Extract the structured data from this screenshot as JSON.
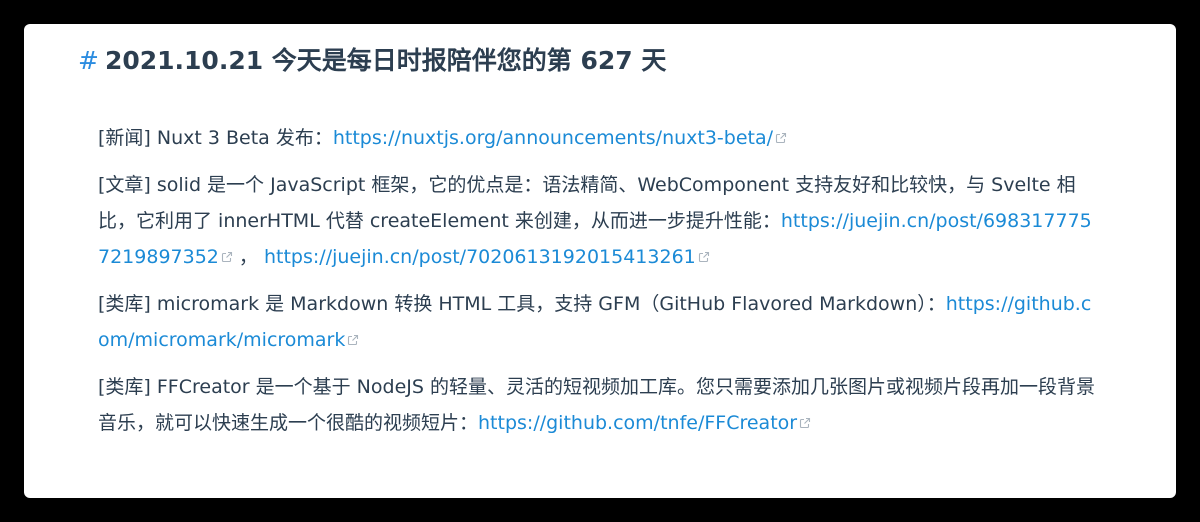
{
  "colors": {
    "text": "#2c3e50",
    "link": "#1b8ad6",
    "hash": "#2b8ce0",
    "background": "#000000",
    "card": "#ffffff"
  },
  "heading": {
    "hash": "#",
    "title": "2021.10.21 今天是每日时报陪伴您的第 627 天"
  },
  "items": [
    {
      "prefix": "[新闻] Nuxt 3 Beta 发布：",
      "link1": "https://nuxtjs.org/announcements/nuxt3-beta/"
    },
    {
      "prefix": "[文章] solid 是一个 JavaScript 框架，它的优点是：语法精简、WebComponent 支持友好和比较快，与 Svelte 相比，它利用了 innerHTML 代替 createElement 来创建，从而进一步提升性能：",
      "link1": "https://juejin.cn/post/6983177757219897352",
      "separator": " ，",
      "link2": "https://juejin.cn/post/7020613192015413261"
    },
    {
      "prefix": "[类库] micromark 是 Markdown 转换 HTML 工具，支持 GFM（GitHub Flavored Markdown）：",
      "link1": "https://github.com/micromark/micromark"
    },
    {
      "prefix": "[类库] FFCreator 是一个基于 NodeJS 的轻量、灵活的短视频加工库。您只需要添加几张图片或视频片段再加一段背景音乐，就可以快速生成一个很酷的视频短片：",
      "link1": "https://github.com/tnfe/FFCreator"
    }
  ]
}
